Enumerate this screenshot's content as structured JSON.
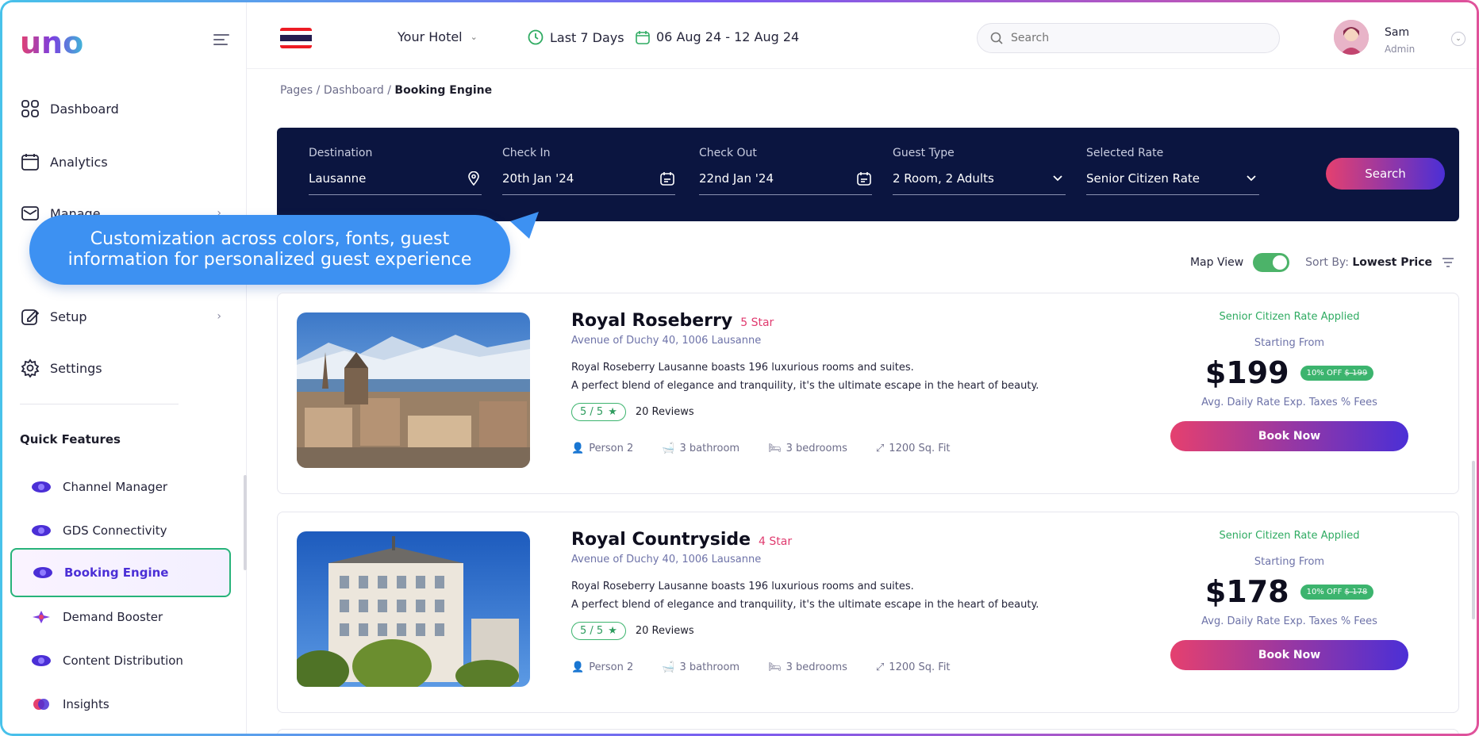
{
  "brand": {
    "logo_text": "uno"
  },
  "sidebar": {
    "items": [
      {
        "label": "Dashboard",
        "icon": "grid-icon"
      },
      {
        "label": "Analytics",
        "icon": "calendar-icon"
      },
      {
        "label": "Manage",
        "icon": "mail-icon"
      },
      {
        "label": "Setup",
        "icon": "edit-icon"
      },
      {
        "label": "Settings",
        "icon": "gear-icon"
      }
    ],
    "quick_title": "Quick Features",
    "quick_items": [
      {
        "label": "Channel Manager"
      },
      {
        "label": "GDS Connectivity"
      },
      {
        "label": "Booking Engine"
      },
      {
        "label": "Demand Booster"
      },
      {
        "label": "Content Distribution"
      },
      {
        "label": "Insights"
      }
    ]
  },
  "header": {
    "hotel": "Your Hotel",
    "period": "Last 7 Days",
    "date_range": "06 Aug 24 - 12 Aug 24",
    "search_placeholder": "Search",
    "user_name": "Sam",
    "user_role": "Admin"
  },
  "breadcrumb": {
    "p1": "Pages",
    "p2": "Dashboard",
    "current": "Booking Engine"
  },
  "search_panel": {
    "destination_label": "Destination",
    "destination": "Lausanne",
    "checkin_label": "Check In",
    "checkin": "20th Jan '24",
    "checkout_label": "Check Out",
    "checkout": "22nd Jan '24",
    "guest_label": "Guest Type",
    "guest": "2 Room, 2 Adults",
    "rate_label": "Selected Rate",
    "rate": "Senior Citizen Rate",
    "button": "Search"
  },
  "tooltip": {
    "line1": "Customization across colors, fonts, guest",
    "line2": "information for personalized guest experience"
  },
  "toolbar": {
    "map_view": "Map View",
    "sort_label": "Sort By:",
    "sort_value": "Lowest Price"
  },
  "hotels": [
    {
      "name": "Royal Roseberry",
      "stars": "5 Star",
      "address": "Avenue of Duchy 40, 1006 Lausanne",
      "desc1": "Royal Roseberry Lausanne boasts 196 luxurious rooms and suites.",
      "desc2": "A perfect blend of elegance and tranquility, it's the ultimate escape in the heart of beauty.",
      "rating": "5 / 5",
      "reviews": "20 Reviews",
      "person": "Person 2",
      "bath": "3 bathroom",
      "bed": "3 bedrooms",
      "area": "1200 Sq. Fit",
      "applied": "Senior Citizen Rate Applied",
      "starting": "Starting From",
      "price": "$199",
      "off": "10% OFF",
      "old_price": "$ 199",
      "avg": "Avg. Daily Rate Exp. Taxes % Fees",
      "book": "Book Now"
    },
    {
      "name": "Royal Countryside",
      "stars": "4 Star",
      "address": "Avenue of Duchy 40, 1006 Lausanne",
      "desc1": "Royal Roseberry Lausanne boasts 196 luxurious rooms and suites.",
      "desc2": "A perfect blend of elegance and tranquility, it's the ultimate escape in the heart of beauty.",
      "rating": "5 / 5",
      "reviews": "20 Reviews",
      "person": "Person 2",
      "bath": "3 bathroom",
      "bed": "3 bedrooms",
      "area": "1200 Sq. Fit",
      "applied": "Senior Citizen Rate Applied",
      "starting": "Starting From",
      "price": "$178",
      "off": "10% OFF",
      "old_price": "$ 178",
      "avg": "Avg. Daily Rate Exp. Taxes % Fees",
      "book": "Book Now"
    }
  ]
}
